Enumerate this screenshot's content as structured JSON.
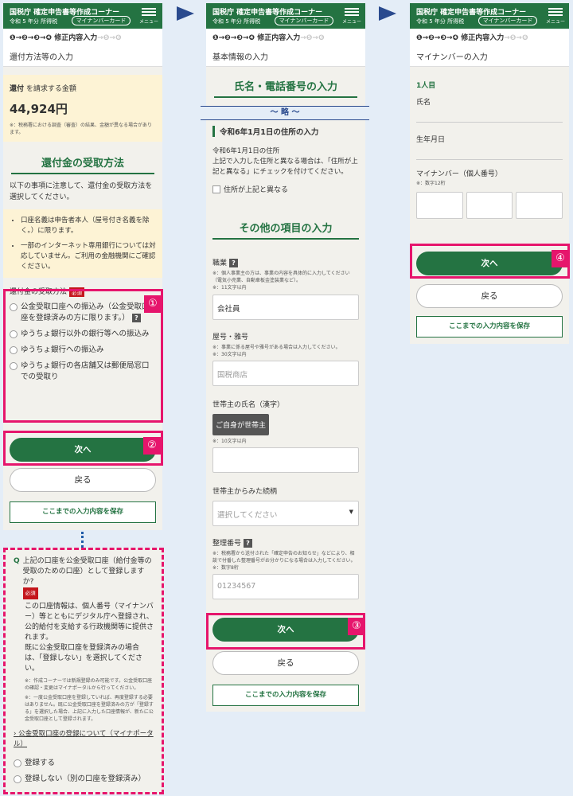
{
  "header": {
    "title": "国税庁 確定申告書等作成コーナー",
    "year": "令和 5 年分 所得税",
    "mynumber_card": "マイナンバーカード",
    "menu_label": "メニュー"
  },
  "steps": {
    "done": "❶→❷→❸→❹ 修正内容入力",
    "rest": "→❺→❻"
  },
  "screen1": {
    "page_title": "還付方法等の入力",
    "refund_label": "還付",
    "refund_label_rest": "を請求する金額",
    "refund_amount": "44,924円",
    "refund_note": "※：税務署における調査（審査）の結果、金額が異なる場合があります。",
    "section_title": "還付金の受取方法",
    "instruction": "以下の事項に注意して、還付金の受取方法を選択してください。",
    "bullets": [
      "口座名義は申告者本人（屋号付き名義を除く。）に限ります。",
      "一部のインターネット専用銀行については対応していません。ご利用の金融機関にご確認ください。"
    ],
    "method_label": "還付金の受取方法",
    "required": "必須",
    "options": [
      "公金受取口座への振込み（公金受取口座を登録済みの方に限ります。）",
      "ゆうちょ銀行以外の銀行等への振込み",
      "ゆうちょ銀行への振込み",
      "ゆうちょ銀行の各店舗又は郵便局窓口での受取り"
    ],
    "next": "次へ",
    "back": "戻る",
    "save": "ここまでの入力内容を保存"
  },
  "popup": {
    "q_mark": "Q",
    "question": "上記の口座を公金受取口座（給付金等の受取のための口座）として登録しますか?",
    "required": "必須",
    "body": "この口座情報は、個人番号（マイナンバー）等とともにデジタル庁へ登録され、公的給付を支給する行政機関等に提供されます。",
    "body2": "既に公金受取口座を登録済みの場合は、「登録しない」を選択してください。",
    "notes": [
      "※：作成コーナーでは新規登録のみ可能です。公金受取口座の確認・変更はマイナポータルから行ってください。",
      "※：一度公金受取口座を登録していれば、再度登録する必要はありません。既に公金受取口座を登録済みの方が「登録する」を選択した場合、上記に入力した口座情報が、新たに公金受取口座として登録されます。"
    ],
    "link": "公金受取口座の登録について（マイナポータル）",
    "options": [
      "登録する",
      "登録しない（別の口座を登録済み）"
    ]
  },
  "screen2": {
    "page_title": "基本情報の入力",
    "section_name_phone": "氏名・電話番号の入力",
    "omitted": "〜 略 〜",
    "address_heading": "令和6年1月1日の住所の入力",
    "address_text": "令和6年1月1日の住所\n上記で入力した住所と異なる場合は、「住所が上記と異なる」にチェックを付けてください。",
    "address_check": "住所が上記と異なる",
    "other_section": "その他の項目の入力",
    "occupation_label": "職業",
    "occupation_note": "※：個人事業主の方は、事業の内容を具体的に入力してください（電気小売業、自動車板金塗装業など）。",
    "occupation_note2": "※：11文字以内",
    "occupation_value": "会社員",
    "trade_label": "屋号・雅号",
    "trade_note": "※：事業に係る屋号や雅号がある場合は入力してください。",
    "trade_note2": "※：30文字以内",
    "trade_placeholder": "国税商店",
    "head_label": "世帯主の氏名（漢字）",
    "head_button": "ご自身が世帯主",
    "head_note": "※：10文字以内",
    "relation_label": "世帯主からみた続柄",
    "relation_placeholder": "選択してください",
    "ref_label": "整理番号",
    "ref_note": "※：税務署から送付された「確定申告のお知らせ」などにより、相談で付番した整理番号がお分かりになる場合は入力してください。",
    "ref_note2": "※：数字8桁",
    "ref_placeholder": "01234567",
    "next": "次へ",
    "back": "戻る",
    "save": "ここまでの入力内容を保存"
  },
  "screen3": {
    "page_title": "マイナンバーの入力",
    "person": "1人目",
    "name_label": "氏名",
    "birth_label": "生年月日",
    "mynumber_label": "マイナンバー（個人番号）",
    "mynumber_note": "※：数字12桁",
    "next": "次へ",
    "back": "戻る",
    "save": "ここまでの入力内容を保存"
  },
  "badges": [
    "①",
    "②",
    "③",
    "④"
  ],
  "colors": {
    "brand_green": "#247342",
    "highlight_pink": "#e6156c",
    "arrow_navy": "#2a4a8e",
    "refund_bg": "#fdf3d5"
  }
}
